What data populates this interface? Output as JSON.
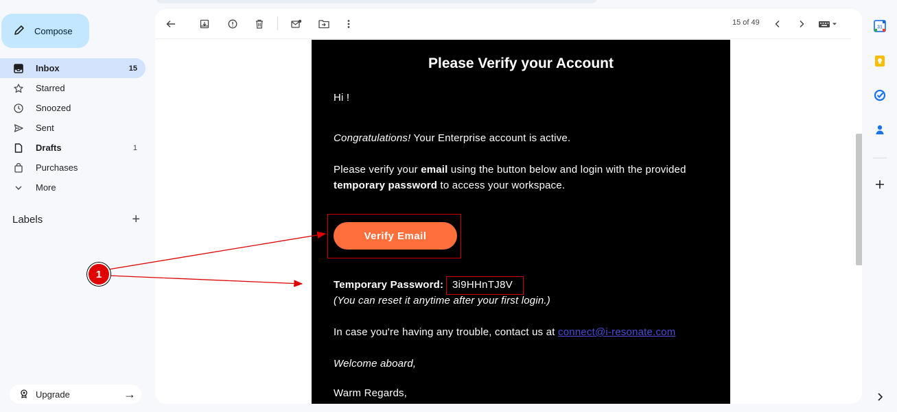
{
  "sidebar": {
    "compose_label": "Compose",
    "items": [
      {
        "label": "Inbox",
        "count": "15",
        "icon": "inbox-icon"
      },
      {
        "label": "Starred",
        "count": "",
        "icon": "star-icon"
      },
      {
        "label": "Snoozed",
        "count": "",
        "icon": "clock-icon"
      },
      {
        "label": "Sent",
        "count": "",
        "icon": "send-icon"
      },
      {
        "label": "Drafts",
        "count": "1",
        "icon": "draft-icon"
      },
      {
        "label": "Purchases",
        "count": "",
        "icon": "shopping-bag-icon"
      },
      {
        "label": "More",
        "count": "",
        "icon": "chevron-down-icon"
      }
    ],
    "labels_title": "Labels",
    "upgrade_label": "Upgrade"
  },
  "toolbar": {
    "pager": "15 of 49"
  },
  "email": {
    "title": "Please Verify your Account",
    "greeting": "Hi !",
    "congrats_em": "Congratulations!",
    "congrats_rest": " Your Enterprise account is active.",
    "verify_part1": "Please verify your ",
    "verify_bold1": "email",
    "verify_part2": " using the button below and login with the provided",
    "verify_bold2": "temporary password",
    "verify_part3": " to access your workspace.",
    "button_label": "Verify Email",
    "password_label": "Temporary Password:",
    "password_value": "3i9HHnTJ8V",
    "reset_note": "(You can reset it anytime after your first login.)",
    "trouble_text": "In case you're having any trouble, contact us at ",
    "contact_email": "connect@i-resonate.com",
    "welcome": "Welcome aboard,",
    "regards": "Warm Regards,"
  },
  "annotation": {
    "badge": "1",
    "color": "#e00000"
  },
  "colors": {
    "accent_button": "#ff6f3c",
    "compose_bg": "#c2e7ff",
    "active_nav": "#d3e3fd"
  }
}
